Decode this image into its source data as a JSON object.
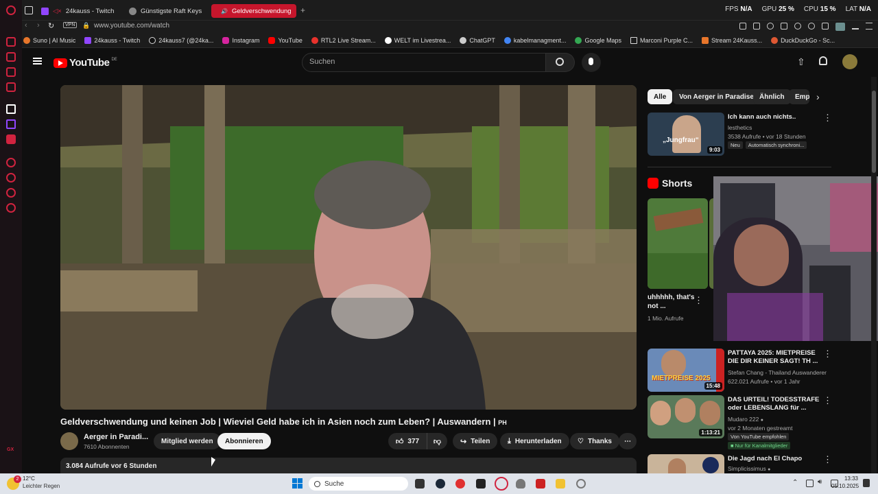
{
  "browser": {
    "tabs": [
      {
        "label": "24kauss - Twitch",
        "active": false
      },
      {
        "label": "Günstigste Raft Keys",
        "active": false
      },
      {
        "label": "Geldverschwendung",
        "active": true
      }
    ],
    "url": "www.youtube.com/watch",
    "vpn_label": "VPN",
    "stats": {
      "fps_label": "FPS",
      "fps": "N/A",
      "gpu_label": "GPU",
      "gpu": "25 %",
      "cpu_label": "CPU",
      "cpu": "15 %",
      "lat_label": "LAT",
      "lat": "N/A"
    },
    "bookmarks": [
      "Suno | AI Music",
      "24kauss - Twitch",
      "24kauss7 (@24ka...",
      "Instagram",
      "YouTube",
      "RTL2 Live Stream...",
      "WELT im Livestrea...",
      "ChatGPT",
      "kabelmanagment...",
      "Google Maps",
      "Marconi Purple C...",
      "Stream 24Kauss...",
      "DuckDuckGo - Sc..."
    ]
  },
  "youtube": {
    "logo": "YouTube",
    "region": "DE",
    "search_placeholder": "Suchen",
    "video": {
      "title": "Geldverschwendung und keinen Job | Wieviel Geld habe ich in Asien noch zum Leben? | Auswandern |",
      "title_suffix": "PH",
      "channel": "Aerger in Paradi...",
      "subscribers": "7610 Abonnenten",
      "member_label": "Mitglied werden",
      "subscribe_label": "Abonnieren",
      "likes": "377",
      "share_label": "Teilen",
      "download_label": "Herunterladen",
      "thanks_label": "Thanks",
      "views": "3.084 Aufrufe",
      "age": "vor 6 Stunden"
    },
    "chips": [
      "Alle",
      "Von Aerger in Paradise",
      "Ähnlich",
      "Emp"
    ],
    "recommendations": [
      {
        "title": "Ich kann auch nichts..",
        "channel": "lesthetics",
        "meta": "3538 Aufrufe • vor 18 Stunden",
        "badges": [
          "Neu",
          "Automatisch synchroni..."
        ],
        "duration": "9:03",
        "thumb_text": "„Jungfrau“"
      },
      {
        "title": "PATTAYA 2025: MIETPREISE DIE DIR KEINER SAGT! TH ...",
        "channel": "Stefan Chang - Thailand Auswanderer",
        "meta": "622.021 Aufrufe • vor 1 Jahr",
        "badges": [],
        "duration": "15:48",
        "thumb_text": "MIETPREISE 2025"
      },
      {
        "title": "DAS URTEIL! TODESSTRAFE oder LEBENSLANG für ...",
        "channel": "Mudaro 222",
        "meta": "vor 2 Monaten gestreamt",
        "badges": [
          "Von YouTube empfohlen",
          "Nur für Kanalmitglieder"
        ],
        "duration": "1:13:21",
        "thumb_text": ""
      },
      {
        "title": "Die Jagd nach El Chapo",
        "channel": "Simplicissimus",
        "meta": "",
        "badges": [],
        "duration": "",
        "thumb_text": ""
      }
    ],
    "shorts": {
      "heading": "Shorts",
      "items": [
        {
          "title": "uhhhhh, that's not ...",
          "views": "1 Mio. Aufrufe"
        }
      ]
    }
  },
  "taskbar": {
    "weather_temp": "12°C",
    "weather_desc": "Leichter Regen",
    "weather_badge": "2",
    "search_label": "Suche",
    "time": "13:33",
    "date": "05.10.2025"
  },
  "colors": {
    "opera_red": "#d1233f",
    "yt_red": "#ff0000",
    "subscribe_bg": "#f1f1f1"
  }
}
